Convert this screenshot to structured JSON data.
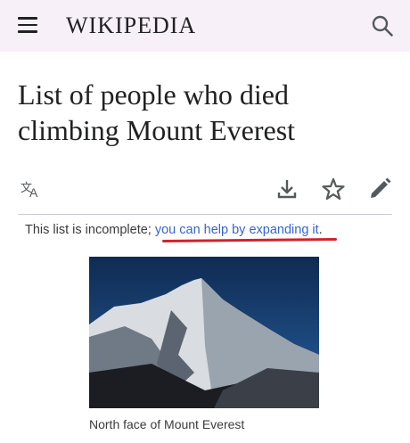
{
  "header": {
    "brand": "WIKIPEDIA",
    "menu_icon": "hamburger-menu-icon",
    "search_icon": "search-icon"
  },
  "article": {
    "title": "List of people who died climbing Mount Everest"
  },
  "toolbar": {
    "icons": [
      "language-icon",
      "download-icon",
      "star-icon",
      "edit-pencil-icon"
    ]
  },
  "hatnote": {
    "prefix": "This list is incomplete; ",
    "link": "you can help by expanding it",
    "suffix": "."
  },
  "figure": {
    "caption": "North face of Mount Everest"
  },
  "colors": {
    "header_bg": "#f8f0f8",
    "link": "#3366cc",
    "annotation": "#d3212c"
  }
}
